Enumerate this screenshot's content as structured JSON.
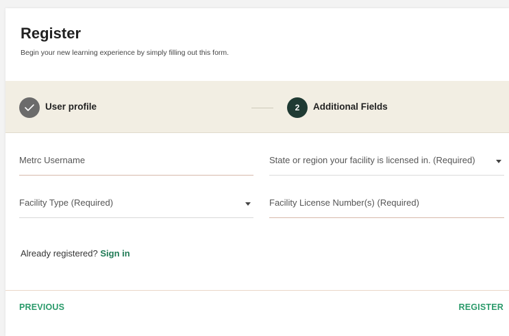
{
  "header": {
    "title": "Register",
    "subtitle": "Begin your new learning experience by simply filling out this form."
  },
  "stepper": {
    "steps": [
      {
        "label": "User profile",
        "status": "completed",
        "icon": "check-icon"
      },
      {
        "label": "Additional Fields",
        "number": "2",
        "status": "active"
      }
    ]
  },
  "form": {
    "metrc_username": {
      "label": "Metrc Username",
      "value": ""
    },
    "state_region": {
      "label": "State or region your facility is licensed in. (Required)",
      "value": ""
    },
    "facility_type": {
      "label": "Facility Type (Required)",
      "value": ""
    },
    "facility_license": {
      "label": "Facility License Number(s)  (Required)",
      "value": ""
    }
  },
  "signin_prompt": {
    "text": "Already registered?",
    "link": "Sign in"
  },
  "footer": {
    "previous_label": "PREVIOUS",
    "register_label": "REGISTER"
  },
  "colors": {
    "accent": "#2a9a6a",
    "stepper_bg": "#f2eee3",
    "active_step": "#1f3a33",
    "completed_step": "#6b6b6b"
  }
}
